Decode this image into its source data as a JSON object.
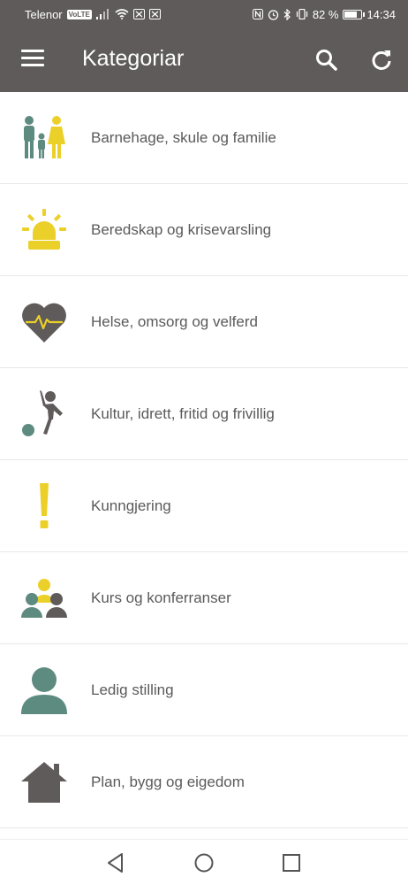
{
  "status_bar": {
    "carrier": "Telenor",
    "volte": "VoLTE",
    "battery_percent": "82 %",
    "time": "14:34",
    "battery_level": 0.82
  },
  "app_bar": {
    "title": "Kategoriar",
    "menu_icon": "menu-icon",
    "search_icon": "search-icon",
    "refresh_icon": "refresh-icon"
  },
  "categories": [
    {
      "label": "Barnehage, skule og familie",
      "icon": "family-icon"
    },
    {
      "label": "Beredskap og krisevarsling",
      "icon": "siren-icon"
    },
    {
      "label": "Helse, omsorg og velferd",
      "icon": "heart-pulse-icon"
    },
    {
      "label": "Kultur, idrett, fritid og frivillig",
      "icon": "sports-icon"
    },
    {
      "label": "Kunngjering",
      "icon": "exclamation-icon"
    },
    {
      "label": "Kurs og konferranser",
      "icon": "group-icon"
    },
    {
      "label": "Ledig stilling",
      "icon": "person-icon"
    },
    {
      "label": "Plan, bygg og eigedom",
      "icon": "house-icon"
    }
  ],
  "colors": {
    "app_bar": "#5f5b5b",
    "teal": "#5e8b80",
    "yellow": "#ecd02a",
    "gray": "#5f5b5b",
    "text": "#5a5a5a"
  }
}
